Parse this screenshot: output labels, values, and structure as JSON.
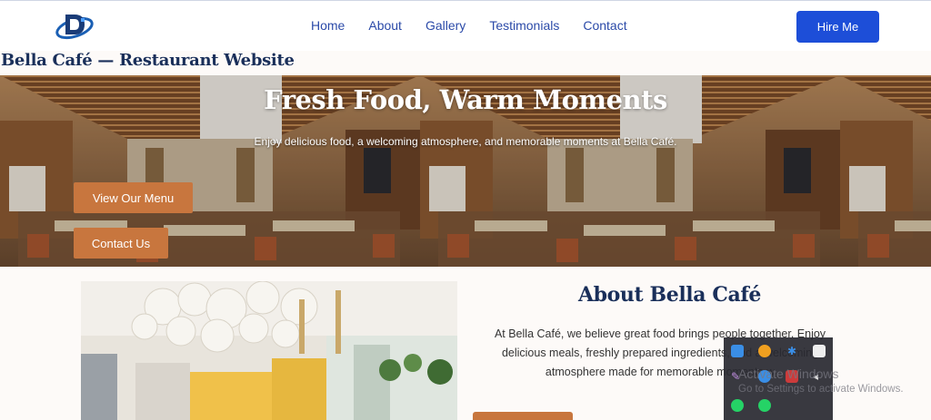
{
  "nav": {
    "links": [
      "Home",
      "About",
      "Gallery",
      "Testimonials",
      "Contact"
    ],
    "cta": "Hire Me"
  },
  "site_title": "Bella Café — Restaurant Website",
  "hero": {
    "title": "Fresh Food, Warm Moments",
    "subtitle": "Enjoy delicious food, a welcoming atmosphere, and memorable moments at Bella Café.",
    "menu_button": "View Our Menu",
    "contact_button": "Contact Us"
  },
  "about": {
    "title": "About Bella Café",
    "text": "At Bella Café, we believe great food brings people together. Enjoy delicious meals, freshly prepared ingredients, and a welcoming atmosphere made for memorable moments w"
  },
  "overlay": {
    "activate_title": "Activate Windows",
    "activate_sub": "Go to Settings to activate Windows."
  },
  "colors": {
    "accent": "#1d4ed8",
    "brand_navy": "#1a2f5a",
    "button_tan": "#c8763e"
  }
}
